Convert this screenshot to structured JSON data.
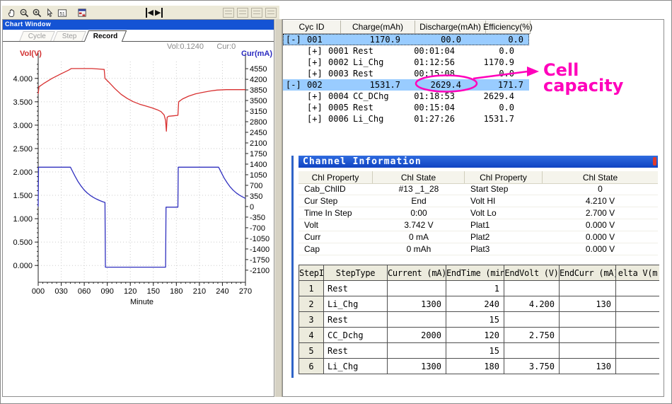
{
  "window": {
    "title": "Chart Window",
    "tabs": [
      {
        "label": "Cycle",
        "active": false
      },
      {
        "label": "Step",
        "active": false
      },
      {
        "label": "Record",
        "active": true
      }
    ],
    "readout": {
      "vol": "Vol:0.1240",
      "cur": "Cur:0"
    }
  },
  "toolbar": {
    "icons": [
      {
        "name": "pan-hand-icon"
      },
      {
        "name": "zoom-icon"
      },
      {
        "name": "zoom-in-icon"
      },
      {
        "name": "select-cursor-icon"
      },
      {
        "name": "data-grid-icon",
        "label": "51"
      },
      {
        "name": "report-icon"
      }
    ],
    "nav_prev": "◀",
    "nav_next": "▶",
    "right_icons": [
      {
        "name": "list-view-icon"
      },
      {
        "name": "column-view-icon"
      },
      {
        "name": "layout-view-icon"
      },
      {
        "name": "copy-icon"
      }
    ]
  },
  "cycle_table": {
    "headers": [
      "Cyc ID",
      "Charge(mAh)",
      "Discharge(mAh)",
      "Efficiency(%)"
    ],
    "rows": [
      {
        "kind": "cycle",
        "expander": "[-]",
        "id": "001",
        "charge": "1170.9",
        "discharge": "00.0",
        "efficiency": "0.0",
        "highlight": true,
        "focus": true
      },
      {
        "kind": "step",
        "expander": "[+]",
        "id": "0001",
        "name": "Rest",
        "time": "00:01:04",
        "value": "0.0"
      },
      {
        "kind": "step",
        "expander": "[+]",
        "id": "0002",
        "name": "Li_Chg",
        "time": "01:12:56",
        "value": "1170.9"
      },
      {
        "kind": "step",
        "expander": "[+]",
        "id": "0003",
        "name": "Rest",
        "time": "00:15:08",
        "value": "0.0"
      },
      {
        "kind": "cycle",
        "expander": "[-]",
        "id": "002",
        "charge": "1531.7",
        "discharge": "2629.4",
        "efficiency": "171.7",
        "highlight": true,
        "circled": "discharge"
      },
      {
        "kind": "step",
        "expander": "[+]",
        "id": "0004",
        "name": "CC_DChg",
        "time": "01:18:53",
        "value": "2629.4"
      },
      {
        "kind": "step",
        "expander": "[+]",
        "id": "0005",
        "name": "Rest",
        "time": "00:15:04",
        "value": "0.0"
      },
      {
        "kind": "step",
        "expander": "[+]",
        "id": "0006",
        "name": "Li_Chg",
        "time": "01:27:26",
        "value": "1531.7"
      }
    ]
  },
  "annotation": {
    "label_line1": "Cell",
    "label_line2": "capacity",
    "color": "#ff00bb",
    "target_value": "2629.4"
  },
  "channel_info": {
    "title": "Channel Information",
    "headers": [
      "Chl Property",
      "Chl State",
      "Chl Property",
      "Chl State"
    ],
    "rows": [
      [
        "Cab_ChlID",
        "#13 _1_28",
        "Start Step",
        "0"
      ],
      [
        "Cur Step",
        "End",
        "Volt HI",
        "4.210 V"
      ],
      [
        "Time In Step",
        "0:00",
        "Volt Lo",
        "2.700 V"
      ],
      [
        "Volt",
        "3.742 V",
        "Plat1",
        "0.000 V"
      ],
      [
        "Curr",
        "0 mA",
        "Plat2",
        "0.000 V"
      ],
      [
        "Cap",
        "0 mAh",
        "Plat3",
        "0.000 V"
      ]
    ]
  },
  "step_table": {
    "headers": [
      "StepID",
      "StepType",
      "Current (mA)",
      "EndTime (min)",
      "EndVolt (V)",
      "EndCurr (mA)",
      "elta V(m"
    ],
    "rows": [
      [
        "1",
        "Rest",
        "",
        "1",
        "",
        "",
        ""
      ],
      [
        "2",
        "Li_Chg",
        "1300",
        "240",
        "4.200",
        "130",
        ""
      ],
      [
        "3",
        "Rest",
        "",
        "15",
        "",
        "",
        ""
      ],
      [
        "4",
        "CC_Dchg",
        "2000",
        "120",
        "2.750",
        "",
        ""
      ],
      [
        "5",
        "Rest",
        "",
        "15",
        "",
        "",
        ""
      ],
      [
        "6",
        "Li_Chg",
        "1300",
        "180",
        "3.750",
        "130",
        ""
      ]
    ]
  },
  "chart_data": {
    "type": "line",
    "x_axis": {
      "label": "Minute",
      "min": 0,
      "max": 270,
      "ticks": [
        0,
        30,
        60,
        90,
        120,
        150,
        180,
        210,
        240,
        270
      ],
      "tick_labels": [
        "000",
        "030",
        "060",
        "090",
        "120",
        "150",
        "180",
        "210",
        "240",
        "270"
      ]
    },
    "left_axis": {
      "label": "Vol(V)",
      "color": "#d22f2f",
      "min": -0.36,
      "max": 4.36,
      "ticks": [
        4.0,
        3.5,
        3.0,
        2.5,
        2.0,
        1.5,
        1.0,
        0.5,
        0.0
      ],
      "tick_labels": [
        "4.000",
        "3.500",
        "3.000",
        "2.500",
        "2.000",
        "1.500",
        "1.000",
        "0.500",
        "0.000"
      ]
    },
    "right_axis": {
      "label": "Cur(mA)",
      "color": "#2a2ac0",
      "min": -2500,
      "max": 4785,
      "ticks": [
        4550,
        4200,
        3850,
        3500,
        3150,
        2800,
        2450,
        2100,
        1750,
        1400,
        1050,
        700,
        350,
        0,
        -350,
        -700,
        -1050,
        -1400,
        -1750,
        -2100
      ],
      "tick_labels": [
        "4550",
        "4200",
        "3850",
        "3500",
        "3150",
        "2800",
        "2450",
        "2100",
        "1750",
        "1400",
        "1050",
        "700",
        "350",
        "0",
        "-350",
        "-700",
        "-1050",
        "-1400",
        "-1750",
        "-2100"
      ]
    },
    "grid": true,
    "series": [
      {
        "name": "Voltage",
        "axis": "left",
        "color": "#d83030",
        "points": [
          [
            0,
            3.67
          ],
          [
            1,
            3.82
          ],
          [
            8,
            3.9
          ],
          [
            18,
            4.0
          ],
          [
            30,
            4.1
          ],
          [
            40,
            4.18
          ],
          [
            43,
            4.21
          ],
          [
            55,
            4.21
          ],
          [
            70,
            4.21
          ],
          [
            80,
            4.2
          ],
          [
            86,
            4.19
          ],
          [
            87,
            4.0
          ],
          [
            92,
            3.92
          ],
          [
            100,
            3.78
          ],
          [
            108,
            3.66
          ],
          [
            116,
            3.57
          ],
          [
            124,
            3.5
          ],
          [
            132,
            3.45
          ],
          [
            140,
            3.41
          ],
          [
            148,
            3.37
          ],
          [
            155,
            3.33
          ],
          [
            160,
            3.29
          ],
          [
            164,
            3.22
          ],
          [
            166,
            3.1
          ],
          [
            167,
            2.87
          ],
          [
            168,
            3.17
          ],
          [
            170,
            3.19
          ],
          [
            176,
            3.2
          ],
          [
            182,
            3.21
          ],
          [
            183,
            3.5
          ],
          [
            188,
            3.56
          ],
          [
            196,
            3.62
          ],
          [
            205,
            3.67
          ],
          [
            214,
            3.7
          ],
          [
            224,
            3.73
          ],
          [
            233,
            3.75
          ],
          [
            245,
            3.76
          ],
          [
            258,
            3.76
          ],
          [
            270,
            3.76
          ]
        ]
      },
      {
        "name": "Current",
        "axis": "right",
        "color": "#3030bf",
        "points": [
          [
            0,
            0
          ],
          [
            0.5,
            1300
          ],
          [
            42,
            1300
          ],
          [
            44,
            1200
          ],
          [
            48,
            1000
          ],
          [
            52,
            820
          ],
          [
            56,
            670
          ],
          [
            60,
            545
          ],
          [
            64,
            445
          ],
          [
            68,
            365
          ],
          [
            72,
            300
          ],
          [
            76,
            245
          ],
          [
            80,
            200
          ],
          [
            84,
            160
          ],
          [
            87,
            135
          ],
          [
            87.5,
            -2000
          ],
          [
            166,
            -2000
          ],
          [
            166.5,
            -20
          ],
          [
            182,
            -20
          ],
          [
            182.5,
            1300
          ],
          [
            235,
            1300
          ],
          [
            238,
            1150
          ],
          [
            242,
            950
          ],
          [
            246,
            790
          ],
          [
            250,
            650
          ],
          [
            254,
            540
          ],
          [
            258,
            450
          ],
          [
            262,
            380
          ],
          [
            266,
            320
          ],
          [
            270,
            270
          ]
        ]
      }
    ]
  }
}
